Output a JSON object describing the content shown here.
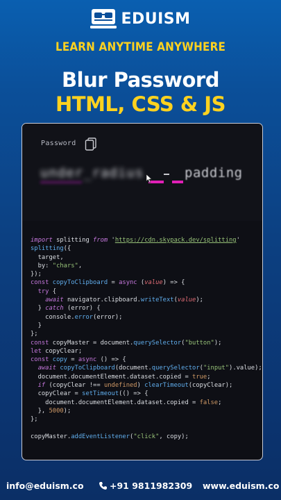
{
  "brand": {
    "name": "EDUISM",
    "tagline": "LEARN ANYTIME ANYWHERE"
  },
  "title": {
    "line1": "Blur Password",
    "line2": "HTML, CSS & JS"
  },
  "preview": {
    "label": "Password",
    "blurred_text": "under_radius",
    "clear_text": "padding"
  },
  "code_lines": [
    [
      [
        "ki",
        "import"
      ],
      [
        "w",
        " splitting "
      ],
      [
        "ki",
        "from"
      ],
      [
        "w",
        " '"
      ],
      [
        "u",
        "https://cdn.skypack.dev/splitting"
      ],
      [
        "w",
        "'"
      ]
    ],
    [
      [
        "f",
        "splitting"
      ],
      [
        "w",
        "({"
      ]
    ],
    [
      [
        "w",
        "  target,"
      ]
    ],
    [
      [
        "w",
        "  by: "
      ],
      [
        "s",
        "\"chars\""
      ],
      [
        "w",
        ","
      ]
    ],
    [
      [
        "w",
        "});"
      ]
    ],
    [
      [
        "k",
        "const"
      ],
      [
        "w",
        " "
      ],
      [
        "f",
        "copyToClipboard"
      ],
      [
        "w",
        " = "
      ],
      [
        "k",
        "async"
      ],
      [
        "w",
        " ("
      ],
      [
        "pi",
        "value"
      ],
      [
        "w",
        ") => {"
      ]
    ],
    [
      [
        "w",
        "  "
      ],
      [
        "k",
        "try"
      ],
      [
        "w",
        " {"
      ]
    ],
    [
      [
        "w",
        "    "
      ],
      [
        "ki",
        "await"
      ],
      [
        "w",
        " navigator.clipboard."
      ],
      [
        "f",
        "writeText"
      ],
      [
        "w",
        "("
      ],
      [
        "pi",
        "value"
      ],
      [
        "w",
        ");"
      ]
    ],
    [
      [
        "w",
        "  } "
      ],
      [
        "ki",
        "catch"
      ],
      [
        "w",
        " (error) {"
      ]
    ],
    [
      [
        "w",
        "    console."
      ],
      [
        "f",
        "error"
      ],
      [
        "w",
        "(error);"
      ]
    ],
    [
      [
        "w",
        "  }"
      ]
    ],
    [
      [
        "w",
        "};"
      ]
    ],
    [
      [
        "k",
        "const"
      ],
      [
        "w",
        " copyMaster = document."
      ],
      [
        "f",
        "querySelector"
      ],
      [
        "w",
        "("
      ],
      [
        "s",
        "\"button\""
      ],
      [
        "w",
        ");"
      ]
    ],
    [
      [
        "k",
        "let"
      ],
      [
        "w",
        " copyClear;"
      ]
    ],
    [
      [
        "k",
        "const"
      ],
      [
        "w",
        " "
      ],
      [
        "f",
        "copy"
      ],
      [
        "w",
        " = "
      ],
      [
        "k",
        "async"
      ],
      [
        "w",
        " () => {"
      ]
    ],
    [
      [
        "w",
        "  "
      ],
      [
        "ki",
        "await"
      ],
      [
        "w",
        " "
      ],
      [
        "f",
        "copyToClipboard"
      ],
      [
        "w",
        "(document."
      ],
      [
        "f",
        "querySelector"
      ],
      [
        "w",
        "("
      ],
      [
        "s",
        "\"input\""
      ],
      [
        "w",
        ").value);"
      ]
    ],
    [
      [
        "w",
        "  document.documentElement.dataset.copied = "
      ],
      [
        "n",
        "true"
      ],
      [
        "w",
        ";"
      ]
    ],
    [
      [
        "w",
        "  "
      ],
      [
        "ki",
        "if"
      ],
      [
        "w",
        " (copyClear !== "
      ],
      [
        "n",
        "undefined"
      ],
      [
        "w",
        ") "
      ],
      [
        "f",
        "clearTimeout"
      ],
      [
        "w",
        "(copyClear);"
      ]
    ],
    [
      [
        "w",
        "  copyClear = "
      ],
      [
        "f",
        "setTimeout"
      ],
      [
        "w",
        "(() => {"
      ]
    ],
    [
      [
        "w",
        "    document.documentElement.dataset.copied = "
      ],
      [
        "n",
        "false"
      ],
      [
        "w",
        ";"
      ]
    ],
    [
      [
        "w",
        "  }, "
      ],
      [
        "n",
        "5000"
      ],
      [
        "w",
        ");"
      ]
    ],
    [
      [
        "w",
        "};"
      ]
    ],
    [
      [
        "w",
        ""
      ]
    ],
    [
      [
        "w",
        "copyMaster."
      ],
      [
        "f",
        "addEventListener"
      ],
      [
        "w",
        "("
      ],
      [
        "s",
        "\"click\""
      ],
      [
        "w",
        ", copy);"
      ]
    ]
  ],
  "footer": {
    "email": "info@eduism.co",
    "phone": "+91 9811982309",
    "website": "www.eduism.co"
  },
  "colors": {
    "accent_yellow": "#ffd21f",
    "pink": "#e01fb6",
    "bg_blue": "#0b4f99"
  },
  "icons": {
    "logo": "glasses-monitor-icon",
    "copy": "clipboard-copy-icon",
    "cursor": "mouse-pointer-icon",
    "phone": "phone-icon"
  }
}
